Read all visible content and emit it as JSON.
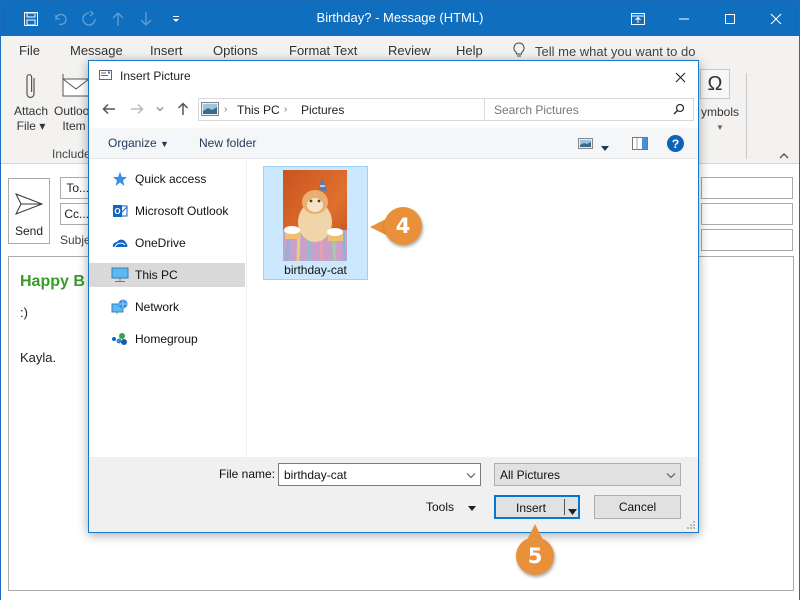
{
  "window": {
    "title": "Birthday? - Message (HTML)",
    "quick_access": [
      "save-icon",
      "undo-icon",
      "redo-icon",
      "up-arrow-icon",
      "down-arrow-icon",
      "customize-icon"
    ],
    "controls": [
      "ribbon-display-icon",
      "minimize-icon",
      "maximize-icon",
      "close-icon"
    ]
  },
  "menu": {
    "items": [
      "File",
      "Message",
      "Insert",
      "Options",
      "Format Text",
      "Review",
      "Help"
    ],
    "active": "Insert",
    "tell_me": "Tell me what you want to do"
  },
  "ribbon": {
    "attach_file": [
      "Attach",
      "File"
    ],
    "outlook_item": [
      "Outlook",
      "Item"
    ],
    "group_label": "Include",
    "symbols_label": "ymbols",
    "symbol_glyph": "Ω"
  },
  "compose": {
    "send_label": "Send",
    "to_label": "To...",
    "cc_label": "Cc...",
    "subject_label": "Subject",
    "greeting": "Happy B",
    "line1": ":)",
    "signature": "Kayla."
  },
  "dialog": {
    "title": "Insert Picture",
    "breadcrumb": [
      "This PC",
      "Pictures"
    ],
    "search_placeholder": "Search Pictures",
    "organize_label": "Organize",
    "new_folder_label": "New folder",
    "nav_items": [
      {
        "label": "Quick access",
        "icon": "star-icon"
      },
      {
        "label": "Microsoft Outlook",
        "icon": "outlook-icon"
      },
      {
        "label": "OneDrive",
        "icon": "cloud-icon"
      },
      {
        "label": "This PC",
        "icon": "computer-icon",
        "selected": true
      },
      {
        "label": "Network",
        "icon": "network-icon"
      },
      {
        "label": "Homegroup",
        "icon": "homegroup-icon"
      }
    ],
    "files": [
      {
        "name": "birthday-cat",
        "selected": true
      }
    ],
    "file_name_label": "File name:",
    "file_name_value": "birthday-cat",
    "file_type": "All Pictures",
    "tools_label": "Tools",
    "insert_label": "Insert",
    "cancel_label": "Cancel"
  },
  "callouts": {
    "step4": "4",
    "step5": "5",
    "color": "#e8913a"
  }
}
